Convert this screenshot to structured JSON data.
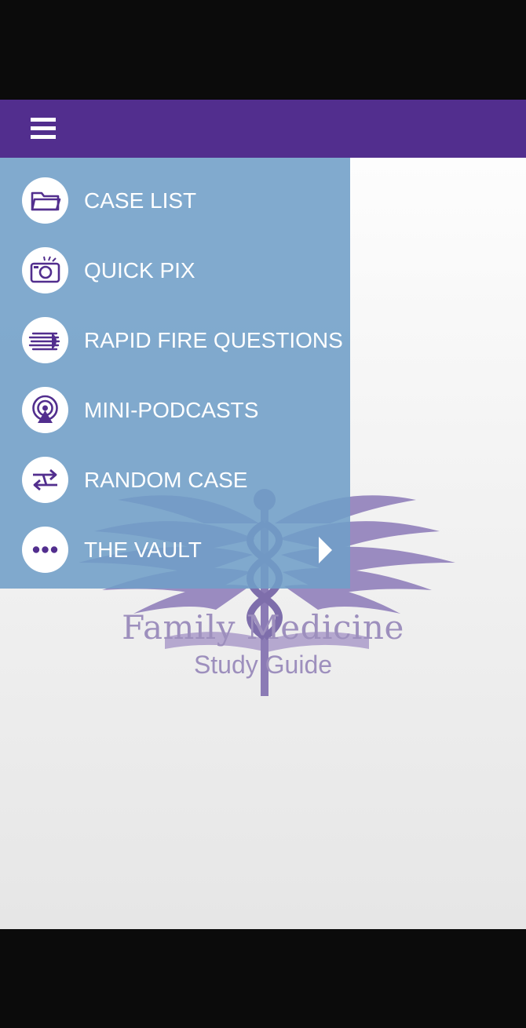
{
  "app": {
    "brand_color": "#522e8e",
    "drawer_color": "#7ba6cd",
    "logo": {
      "title": "Family Medicine",
      "subtitle": "Study Guide"
    }
  },
  "topbar": {
    "menu_icon": "hamburger-icon"
  },
  "menu": {
    "items": [
      {
        "label": "CASE LIST",
        "icon": "folder-icon"
      },
      {
        "label": "QUICK PIX",
        "icon": "camera-icon"
      },
      {
        "label": "RAPID FIRE QUESTIONS",
        "icon": "speed-lines-icon"
      },
      {
        "label": "MINI-PODCASTS",
        "icon": "podcast-icon"
      },
      {
        "label": "RANDOM CASE",
        "icon": "shuffle-icon"
      },
      {
        "label": "THE VAULT",
        "icon": "more-dots-icon",
        "submenu_icon": "chevron-right-icon"
      }
    ]
  }
}
